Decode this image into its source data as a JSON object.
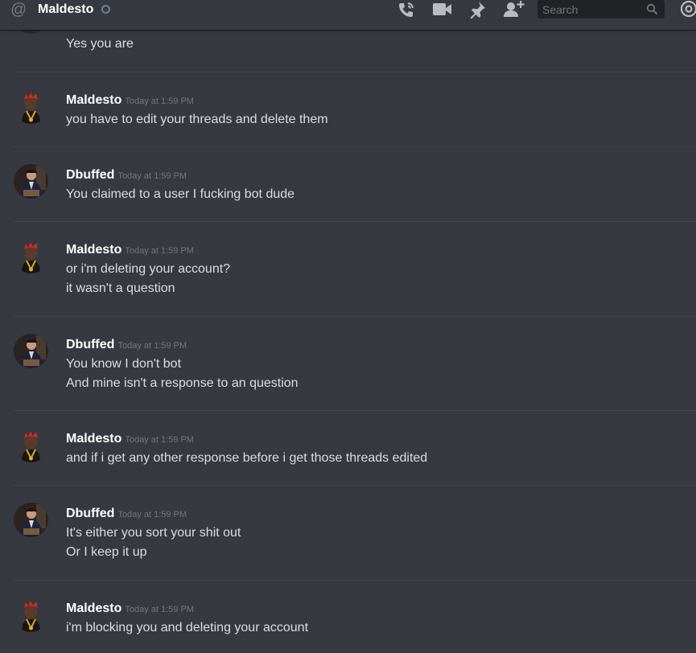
{
  "header": {
    "title": "Maldesto",
    "search_placeholder": "Search",
    "icons": [
      "at-icon",
      "status-dot",
      "call-icon",
      "video-icon",
      "pin-icon",
      "add-user-icon",
      "search-icon",
      "mention-icon"
    ]
  },
  "top_partial_message": {
    "text": "Yes you are"
  },
  "groups": [
    {
      "username": "Maldesto",
      "timestamp": "Today at 1:59 PM",
      "avatar": "maldesto-avatar",
      "lines": [
        "you have to edit your threads and delete them"
      ]
    },
    {
      "username": "Dbuffed",
      "timestamp": "Today at 1:59 PM",
      "avatar": "dbuffed-avatar",
      "lines": [
        "You claimed to a user I fucking bot dude"
      ]
    },
    {
      "username": "Maldesto",
      "timestamp": "Today at 1:59 PM",
      "avatar": "maldesto-avatar",
      "lines": [
        "or i'm deleting your account?",
        "it wasn't a question"
      ]
    },
    {
      "username": "Dbuffed",
      "timestamp": "Today at 1:59 PM",
      "avatar": "dbuffed-avatar",
      "lines": [
        "You know I don't bot",
        "And mine isn't a response to an question"
      ]
    },
    {
      "username": "Maldesto",
      "timestamp": "Today at 1:59 PM",
      "avatar": "maldesto-avatar",
      "lines": [
        "and if i get any other response before i get those threads edited"
      ]
    },
    {
      "username": "Dbuffed",
      "timestamp": "Today at 1:59 PM",
      "avatar": "dbuffed-avatar",
      "lines": [
        "It's either you sort your shit out",
        "Or I keep it up"
      ]
    },
    {
      "username": "Maldesto",
      "timestamp": "Today at 1:59 PM",
      "avatar": "maldesto-avatar",
      "lines": [
        "i'm blocking you and deleting your account"
      ]
    }
  ],
  "colors": {
    "background": "#36393f",
    "divider": "#40444b",
    "username": "#ffffff",
    "text": "#dcddde",
    "timestamp": "#72767d"
  }
}
